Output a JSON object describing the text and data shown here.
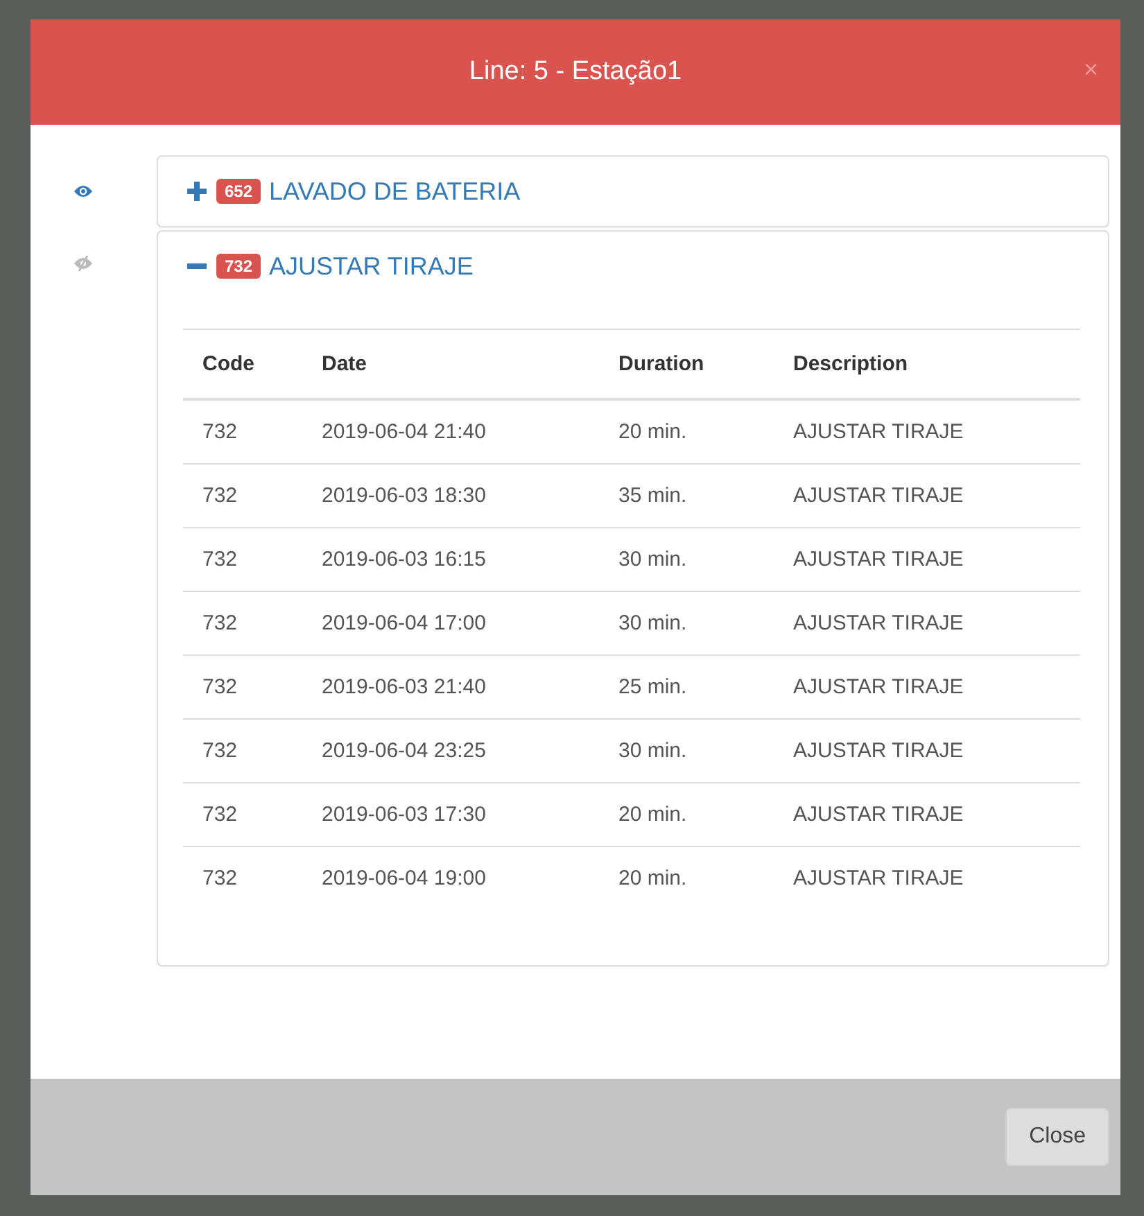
{
  "modal": {
    "title": "Line: 5 - Estação1",
    "close_symbol": "×"
  },
  "toggles": [
    {
      "visible": true
    },
    {
      "visible": false
    }
  ],
  "panels": [
    {
      "badge": "652",
      "title": "LAVADO DE BATERIA",
      "expanded": false
    },
    {
      "badge": "732",
      "title": "AJUSTAR TIRAJE",
      "expanded": true,
      "table": {
        "columns": [
          "Code",
          "Date",
          "Duration",
          "Description"
        ],
        "rows": [
          [
            "732",
            "2019-06-04 21:40",
            "20 min.",
            "AJUSTAR TIRAJE"
          ],
          [
            "732",
            "2019-06-03 18:30",
            "35 min.",
            "AJUSTAR TIRAJE"
          ],
          [
            "732",
            "2019-06-03 16:15",
            "30 min.",
            "AJUSTAR TIRAJE"
          ],
          [
            "732",
            "2019-06-04 17:00",
            "30 min.",
            "AJUSTAR TIRAJE"
          ],
          [
            "732",
            "2019-06-03 21:40",
            "25 min.",
            "AJUSTAR TIRAJE"
          ],
          [
            "732",
            "2019-06-04 23:25",
            "30 min.",
            "AJUSTAR TIRAJE"
          ],
          [
            "732",
            "2019-06-03 17:30",
            "20 min.",
            "AJUSTAR TIRAJE"
          ],
          [
            "732",
            "2019-06-04 19:00",
            "20 min.",
            "AJUSTAR TIRAJE"
          ]
        ]
      }
    }
  ],
  "footer": {
    "button": "Close"
  }
}
